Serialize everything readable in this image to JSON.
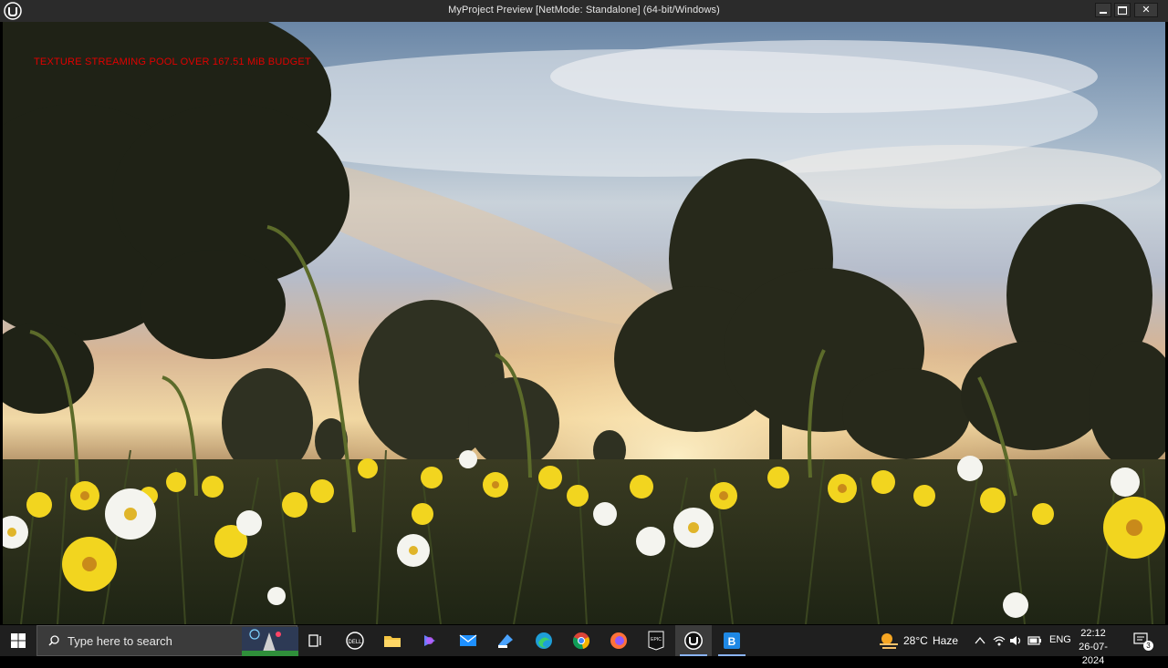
{
  "window": {
    "title": "MyProject Preview [NetMode: Standalone]  (64-bit/Windows)",
    "app_icon": "unreal-engine-logo"
  },
  "viewport": {
    "warning_text": "TEXTURE STREAMING POOL OVER 167.51 MiB BUDGET",
    "warning_color": "#e00000",
    "scene": "meadow with yellow and white daffodils, silhouetted trees, sunset sky"
  },
  "taskbar": {
    "search_placeholder": "Type here to search",
    "pinned": [
      {
        "name": "task-view-icon"
      },
      {
        "name": "dell-icon"
      },
      {
        "name": "copilot-icon"
      },
      {
        "name": "file-explorer-icon"
      },
      {
        "name": "mail-icon"
      },
      {
        "name": "store-icon"
      },
      {
        "name": "edge-icon"
      },
      {
        "name": "chrome-icon"
      },
      {
        "name": "firefox-icon"
      },
      {
        "name": "epic-games-icon"
      },
      {
        "name": "unreal-engine-icon"
      },
      {
        "name": "blue-app-icon"
      }
    ],
    "weather": {
      "temp": "28°C",
      "desc": "Haze"
    },
    "language": "ENG",
    "time": "22:12",
    "date": "26-07-2024",
    "notification_count": "3"
  }
}
